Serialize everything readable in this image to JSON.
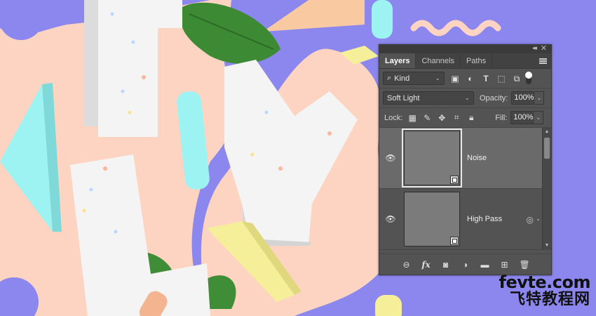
{
  "panel": {
    "tabs": [
      {
        "label": "Layers",
        "active": true
      },
      {
        "label": "Channels",
        "active": false
      },
      {
        "label": "Paths",
        "active": false
      }
    ],
    "filter": {
      "kind_label": "Kind"
    },
    "blend_mode": "Soft Light",
    "opacity_label": "Opacity:",
    "opacity_value": "100%",
    "lock_label": "Lock:",
    "fill_label": "Fill:",
    "fill_value": "100%",
    "layers": [
      {
        "name": "Noise",
        "selected": true,
        "visible": true,
        "smart_object": true
      },
      {
        "name": "High Pass",
        "selected": false,
        "visible": true,
        "smart_object": true,
        "has_filter_effects": true
      }
    ],
    "footer_icons": [
      "link-icon",
      "fx-icon",
      "mask-icon",
      "adjustment-icon",
      "folder-icon",
      "new-layer-icon",
      "trash-icon"
    ]
  },
  "watermark": {
    "line1": "fevte.com",
    "line2": "飞特教程网"
  },
  "colors": {
    "background_purple": "#8c87ee",
    "peach": "#fdd4c2",
    "panel_gray": "#535353",
    "selected_layer": "#6a6a6a",
    "cyan_shape": "#9df2f2",
    "yellow_shape": "#f5ef9a"
  }
}
